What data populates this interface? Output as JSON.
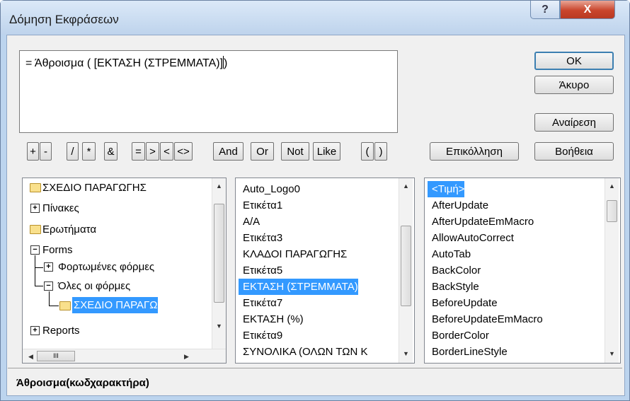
{
  "window": {
    "title": "Δόμηση Εκφράσεων",
    "help_label": "?",
    "close_label": "X"
  },
  "expression": {
    "text": "= Άθροισμα ( [ΕΚΤΑΣΗ (ΣΤΡΕΜΜΑΤΑ)]",
    " suffix": ")"
  },
  "buttons": {
    "ok": "OK",
    "cancel": "Άκυρο",
    "undo": "Αναίρεση",
    "paste": "Επικόλληση",
    "help": "Βοήθεια"
  },
  "operators": [
    "+",
    "-",
    "/",
    "*",
    "&",
    "=",
    ">",
    "<",
    "<>",
    "And",
    "Or",
    "Not",
    "Like",
    "(",
    ")"
  ],
  "tree": {
    "items": [
      {
        "label": "ΣΧΕΔΙΟ ΠΑΡΑΓΩΓΗΣ"
      },
      {
        "label": "Πίνακες"
      },
      {
        "label": "Ερωτήματα"
      },
      {
        "label": "Forms"
      },
      {
        "label": "Φορτωμένες φόρμες"
      },
      {
        "label": "Όλες οι φόρμες"
      },
      {
        "label": "ΣΧΕΔΙΟ ΠΑΡΑΓΩ"
      },
      {
        "label": "Reports"
      }
    ],
    "hscroll_grip": "III"
  },
  "controls": {
    "items": [
      "Auto_Logo0",
      "Ετικέτα1",
      "Α/Α",
      "Ετικέτα3",
      "ΚΛΑΔΟΙ ΠΑΡΑΓΩΓΗΣ",
      "Ετικέτα5",
      "ΕΚΤΑΣΗ (ΣΤΡΕΜΜΑΤΑ)",
      "Ετικέτα7",
      "ΕΚΤΑΣΗ  (%)",
      "Ετικέτα9",
      "ΣΥΝΟΛΙΚΑ (ΟΛΩΝ ΤΩΝ Κ"
    ],
    "selected_index": 6
  },
  "properties": {
    "items": [
      "<Τιμή>",
      "AfterUpdate",
      "AfterUpdateEmMacro",
      "AllowAutoCorrect",
      "AutoTab",
      "BackColor",
      "BackStyle",
      "BeforeUpdate",
      "BeforeUpdateEmMacro",
      "BorderColor",
      "BorderLineStyle"
    ],
    "selected_index": 0
  },
  "status": {
    "text": "Άθροισμα(κωδχαρακτήρα)"
  }
}
